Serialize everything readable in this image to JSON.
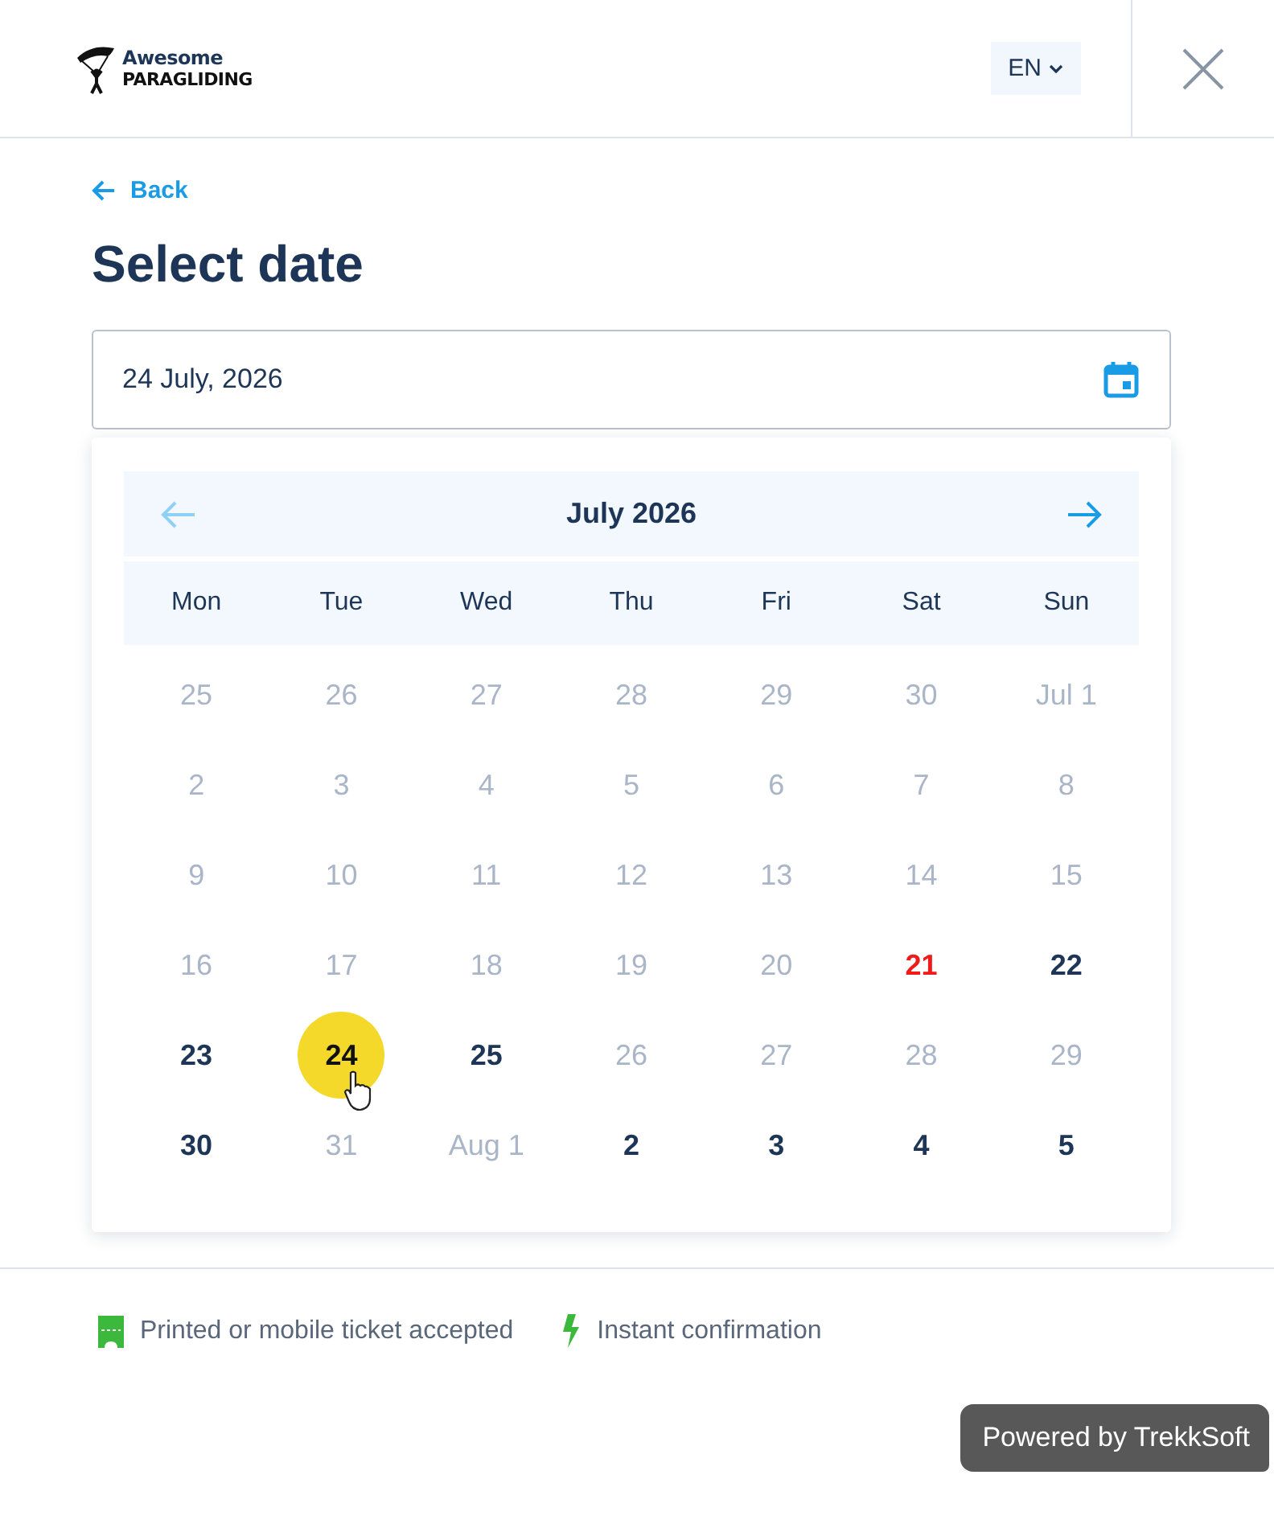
{
  "header": {
    "brand_line_1": "Awesome",
    "brand_line_2": "PARAGLIDING",
    "language": "EN"
  },
  "back_link": "Back",
  "title": "Select date",
  "date_field": {
    "value": "24 July, 2026"
  },
  "calendar": {
    "month": "July 2026",
    "prev_disabled": true,
    "weekdays": [
      "Mon",
      "Tue",
      "Wed",
      "Thu",
      "Fri",
      "Sat",
      "Sun"
    ],
    "weeks": [
      [
        {
          "label": "25",
          "kind": "unavailable",
          "selected": false
        },
        {
          "label": "26",
          "kind": "unavailable",
          "selected": false
        },
        {
          "label": "27",
          "kind": "unavailable",
          "selected": false
        },
        {
          "label": "28",
          "kind": "unavailable",
          "selected": false
        },
        {
          "label": "29",
          "kind": "unavailable",
          "selected": false
        },
        {
          "label": "30",
          "kind": "unavailable",
          "selected": false
        },
        {
          "label": "Jul 1",
          "kind": "unavailable",
          "selected": false
        }
      ],
      [
        {
          "label": "2",
          "kind": "unavailable",
          "selected": false
        },
        {
          "label": "3",
          "kind": "unavailable",
          "selected": false
        },
        {
          "label": "4",
          "kind": "unavailable",
          "selected": false
        },
        {
          "label": "5",
          "kind": "unavailable",
          "selected": false
        },
        {
          "label": "6",
          "kind": "unavailable",
          "selected": false
        },
        {
          "label": "7",
          "kind": "unavailable",
          "selected": false
        },
        {
          "label": "8",
          "kind": "unavailable",
          "selected": false
        }
      ],
      [
        {
          "label": "9",
          "kind": "unavailable",
          "selected": false
        },
        {
          "label": "10",
          "kind": "unavailable",
          "selected": false
        },
        {
          "label": "11",
          "kind": "unavailable",
          "selected": false
        },
        {
          "label": "12",
          "kind": "unavailable",
          "selected": false
        },
        {
          "label": "13",
          "kind": "unavailable",
          "selected": false
        },
        {
          "label": "14",
          "kind": "unavailable",
          "selected": false
        },
        {
          "label": "15",
          "kind": "unavailable",
          "selected": false
        }
      ],
      [
        {
          "label": "16",
          "kind": "unavailable",
          "selected": false
        },
        {
          "label": "17",
          "kind": "unavailable",
          "selected": false
        },
        {
          "label": "18",
          "kind": "unavailable",
          "selected": false
        },
        {
          "label": "19",
          "kind": "unavailable",
          "selected": false
        },
        {
          "label": "20",
          "kind": "unavailable",
          "selected": false
        },
        {
          "label": "21",
          "kind": "today",
          "selected": false
        },
        {
          "label": "22",
          "kind": "available",
          "selected": false
        }
      ],
      [
        {
          "label": "23",
          "kind": "available",
          "selected": false
        },
        {
          "label": "24",
          "kind": "available",
          "selected": true
        },
        {
          "label": "25",
          "kind": "available",
          "selected": false
        },
        {
          "label": "26",
          "kind": "unavailable",
          "selected": false
        },
        {
          "label": "27",
          "kind": "unavailable",
          "selected": false
        },
        {
          "label": "28",
          "kind": "unavailable",
          "selected": false
        },
        {
          "label": "29",
          "kind": "unavailable",
          "selected": false
        }
      ],
      [
        {
          "label": "30",
          "kind": "available",
          "selected": false
        },
        {
          "label": "31",
          "kind": "unavailable",
          "selected": false
        },
        {
          "label": "Aug 1",
          "kind": "unavailable",
          "selected": false
        },
        {
          "label": "2",
          "kind": "available",
          "selected": false
        },
        {
          "label": "3",
          "kind": "available",
          "selected": false
        },
        {
          "label": "4",
          "kind": "available",
          "selected": false
        },
        {
          "label": "5",
          "kind": "available",
          "selected": false
        }
      ]
    ]
  },
  "features": [
    {
      "kind": "ticket",
      "text": "Printed or mobile ticket accepted"
    },
    {
      "kind": "instant",
      "text": "Instant confirmation"
    }
  ],
  "powered_by": "Powered by TrekkSoft"
}
